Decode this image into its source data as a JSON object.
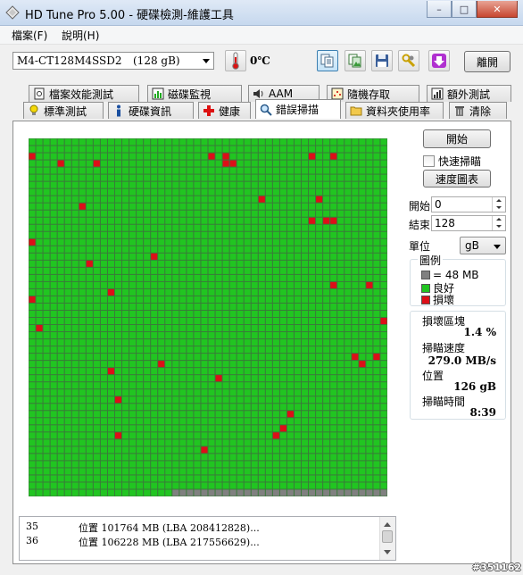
{
  "window": {
    "title": "HD Tune Pro  5.00 - 硬碟檢測-維護工具",
    "minimize_glyph": "–",
    "maximize_glyph": "□",
    "close_glyph": "✕"
  },
  "menu": {
    "file": "檔案(F)",
    "help": "說明(H)"
  },
  "toolbar": {
    "drive_name": "M4-CT128M4SSD2",
    "drive_size": "(128 gB)",
    "temperature": "0℃",
    "exit_label": "離開"
  },
  "tabs": {
    "row_top": [
      "檔案效能測試",
      "磁碟監視",
      "AAM",
      "隨機存取",
      "額外測試"
    ],
    "row_bottom": [
      "標準測試",
      "硬碟資訊",
      "健康",
      "錯誤掃描",
      "資料夾使用率",
      "清除"
    ],
    "active": "錯誤掃描"
  },
  "controls": {
    "start_label": "開始",
    "quick_scan_label": "快速掃瞄",
    "speed_map_label": "速度圖表",
    "start_field_label": "開始",
    "start_value": "0",
    "end_field_label": "結束",
    "end_value": "128",
    "unit_label": "單位",
    "unit_value": "gB"
  },
  "legend": {
    "title": "圖例",
    "block_size": "= 48 MB",
    "good": "良好",
    "damaged": "損壞"
  },
  "stats": {
    "damaged_blocks_label": "損壞區塊",
    "damaged_blocks_value": "1.4 %",
    "scan_speed_label": "掃瞄速度",
    "scan_speed_value": "279.0 MB/s",
    "position_label": "位置",
    "position_value": "126 gB",
    "scan_time_label": "掃瞄時間",
    "scan_time_value": "8:39"
  },
  "log": [
    {
      "num": "35",
      "text": "位置 101764 MB (LBA 208412828)..."
    },
    {
      "num": "36",
      "text": "位置 106228 MB (LBA 217556629)..."
    }
  ],
  "scan_map": {
    "columns": 50,
    "rows": 50,
    "scanned_blocks": 2470,
    "colors": {
      "good": "#21c521",
      "damaged": "#dc0f18",
      "unscanned": "#808080",
      "grid": "#3a7a3a"
    },
    "damaged_cells": [
      [
        2,
        0
      ],
      [
        2,
        25
      ],
      [
        2,
        27
      ],
      [
        2,
        39
      ],
      [
        2,
        42
      ],
      [
        3,
        4
      ],
      [
        3,
        9
      ],
      [
        3,
        27
      ],
      [
        3,
        28
      ],
      [
        8,
        32
      ],
      [
        8,
        40
      ],
      [
        9,
        7
      ],
      [
        11,
        39
      ],
      [
        11,
        41
      ],
      [
        11,
        42
      ],
      [
        14,
        0
      ],
      [
        16,
        17
      ],
      [
        17,
        8
      ],
      [
        20,
        42
      ],
      [
        20,
        47
      ],
      [
        21,
        11
      ],
      [
        22,
        0
      ],
      [
        25,
        49
      ],
      [
        26,
        1
      ],
      [
        30,
        45
      ],
      [
        30,
        48
      ],
      [
        31,
        18
      ],
      [
        31,
        46
      ],
      [
        32,
        11
      ],
      [
        33,
        26
      ],
      [
        36,
        12
      ],
      [
        38,
        36
      ],
      [
        40,
        35
      ],
      [
        41,
        34
      ],
      [
        41,
        12
      ],
      [
        43,
        24
      ]
    ]
  },
  "watermark": "#351162"
}
